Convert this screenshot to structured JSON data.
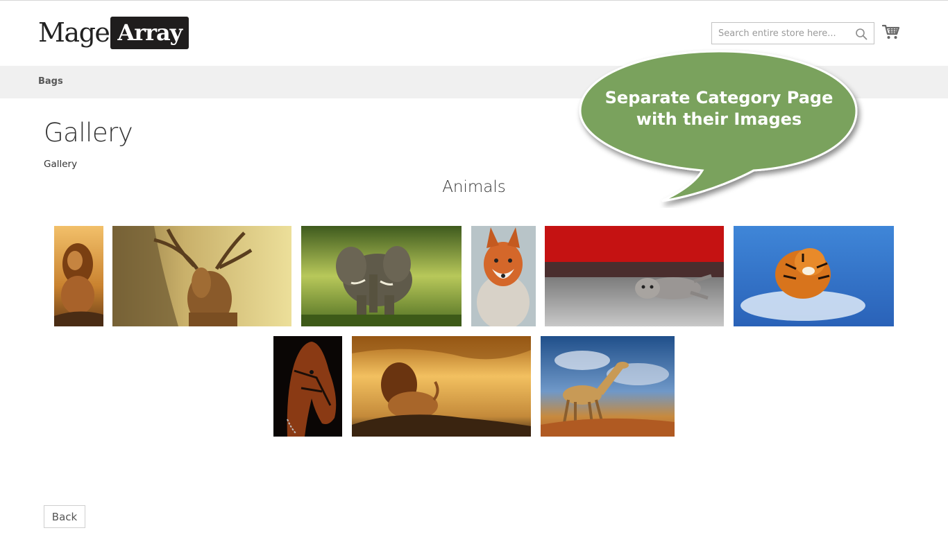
{
  "header": {
    "logo_part1": "Mage",
    "logo_part2": "Array",
    "search_placeholder": "Search entire store here...",
    "search_icon": "search-icon",
    "cart_icon": "cart-icon"
  },
  "nav": {
    "items": [
      {
        "label": "Bags"
      }
    ]
  },
  "page": {
    "title": "Gallery",
    "sub_label": "Gallery",
    "category_title": "Animals"
  },
  "gallery": {
    "images": [
      {
        "subject": "lion"
      },
      {
        "subject": "deer"
      },
      {
        "subject": "elephant"
      },
      {
        "subject": "fox"
      },
      {
        "subject": "kitten"
      },
      {
        "subject": "tiger"
      },
      {
        "subject": "horse"
      },
      {
        "subject": "lion-sunset"
      },
      {
        "subject": "giraffe"
      }
    ]
  },
  "callout": {
    "text": "Separate Category Page\nwith their Images",
    "color": "#7aa25d"
  },
  "buttons": {
    "back_label": "Back"
  }
}
